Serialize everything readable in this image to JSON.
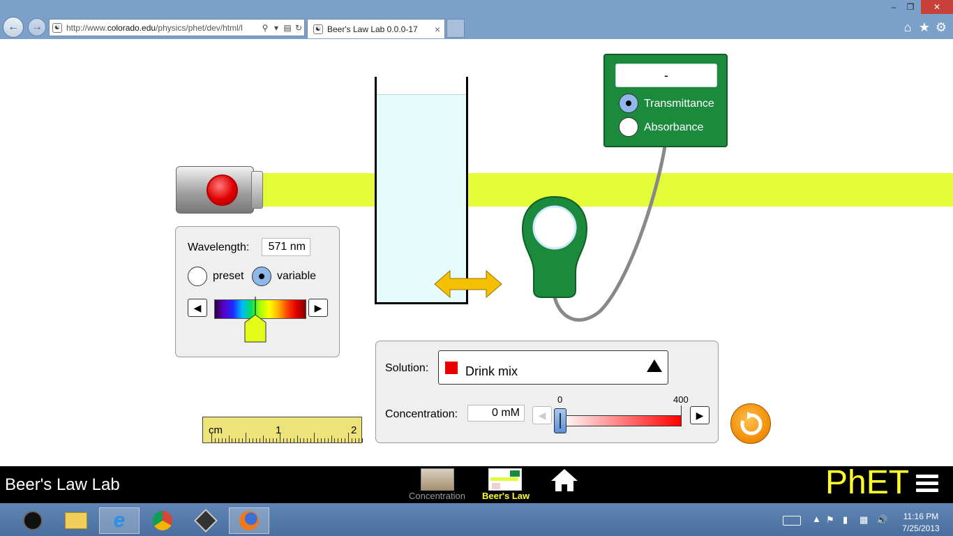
{
  "browser": {
    "url_prefix": "http://www.",
    "url_domain": "colorado.edu",
    "url_suffix": "/physics/phet/dev/html/l",
    "tab_title": "Beer's Law Lab 0.0.0-17",
    "tab_close": "×",
    "window_minimize": "–",
    "window_restore": "❐",
    "window_close": "✕"
  },
  "wavelength_panel": {
    "label": "Wavelength:",
    "value": "571 nm",
    "preset_label": "preset",
    "variable_label": "variable",
    "mode": "variable"
  },
  "detector": {
    "readout": "-",
    "transmittance_label": "Transmittance",
    "absorbance_label": "Absorbance",
    "mode": "transmittance"
  },
  "solution_panel": {
    "solution_label": "Solution:",
    "solution_value": "Drink mix",
    "solution_color": "#ee0000",
    "concentration_label": "Concentration:",
    "concentration_value": "0 mM",
    "slider_min_label": "0",
    "slider_max_label": "400",
    "concentration_fraction": 0.0
  },
  "ruler": {
    "unit": "cm",
    "label_1": "1",
    "label_2": "2"
  },
  "navbar": {
    "sim_title": "Beer's Law Lab",
    "screens": [
      {
        "label": "Concentration",
        "selected": false
      },
      {
        "label": "Beer's Law",
        "selected": true
      }
    ],
    "logo": "PhET"
  },
  "colors": {
    "beam": "#e3fb38",
    "meter_green": "#1c8a3c",
    "phet_yellow": "#ffff2a",
    "selected_screen": "#ffff2a"
  },
  "taskbar": {
    "time": "11:16 PM",
    "date": "7/25/2013"
  }
}
